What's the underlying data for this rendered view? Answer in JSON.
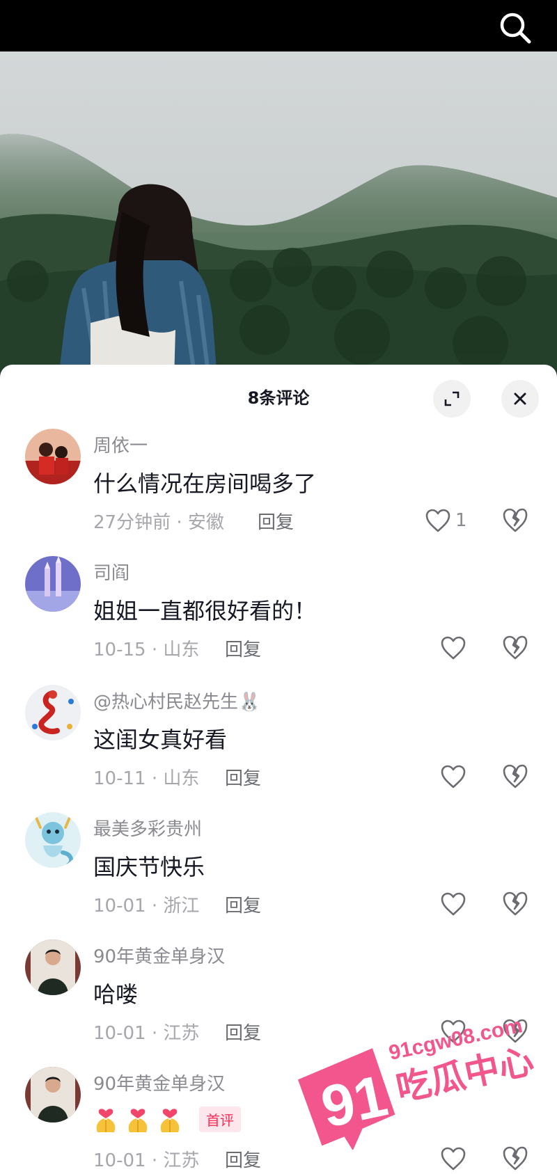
{
  "header": {
    "search_icon": "search-icon"
  },
  "sheet": {
    "title": "8条评论",
    "expand_icon": "expand-icon",
    "close_icon": "close-icon"
  },
  "comments": [
    {
      "username": "周依一",
      "text": "什么情况在房间喝多了",
      "time": "27分钟前 · 安徽",
      "reply": "回复",
      "likes": "1",
      "avatar": "red-photo-avatar"
    },
    {
      "username": "司阎",
      "text": "姐姐一直都很好看的！",
      "time": "10-15 · 山东",
      "reply": "回复",
      "likes": "",
      "avatar": "castle-avatar"
    },
    {
      "username": "@热心村民赵先生🐰",
      "text": "这闺女真好看",
      "time": "10-11 · 山东",
      "reply": "回复",
      "likes": "",
      "avatar": "dragon-avatar"
    },
    {
      "username": "最美多彩贵州",
      "text": "国庆节快乐",
      "time": "10-01 · 浙江",
      "reply": "回复",
      "likes": "",
      "avatar": "blue-dragon-avatar"
    },
    {
      "username": "90年黄金单身汉",
      "text": "哈喽",
      "time": "10-01 · 江苏",
      "reply": "回复",
      "likes": "",
      "avatar": "man-photo-avatar"
    },
    {
      "username": "90年黄金单身汉",
      "text": "",
      "emojis": "pray-heart-emoji ×3",
      "badge": "首评",
      "time": "10-01 · 江苏",
      "reply": "回复",
      "likes": "",
      "avatar": "man-photo-avatar"
    }
  ],
  "watermark": {
    "url": "91cgw08.com",
    "number": "91",
    "text": "吃瓜中心"
  },
  "colors": {
    "accent": "#fe2c55",
    "watermark": "#f2568c"
  }
}
